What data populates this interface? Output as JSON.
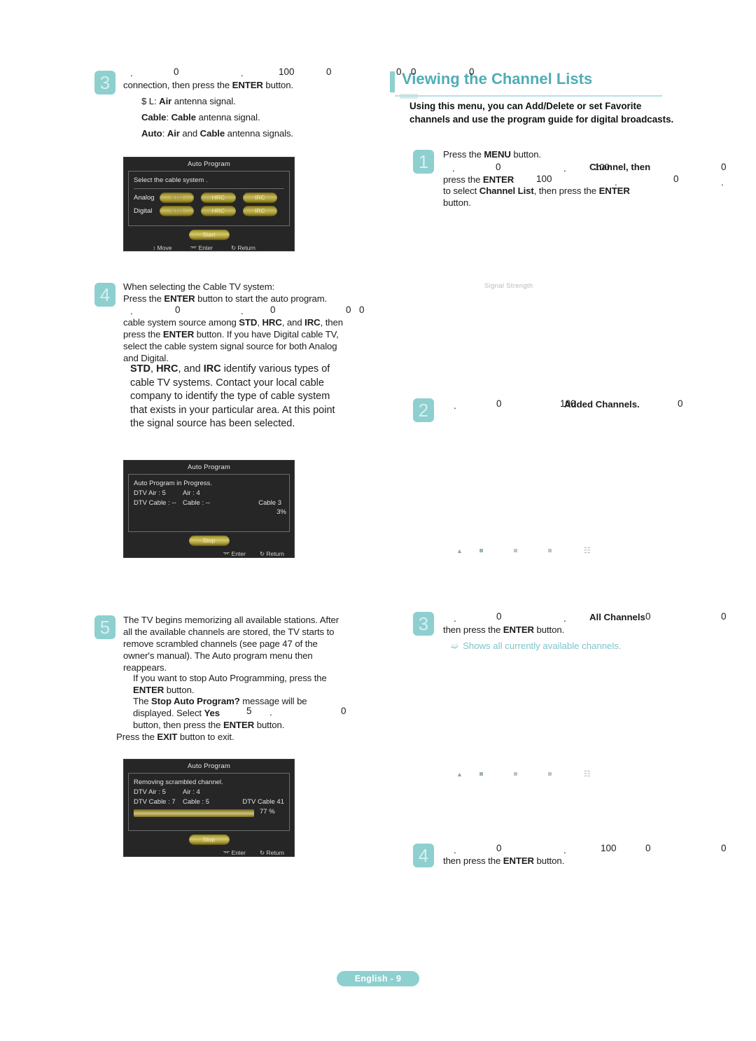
{
  "document": {
    "footer_label": "English - 9",
    "accent": "#8ecfcf",
    "heading_color": "#4fadb5",
    "note_color": "#7ec4cc"
  },
  "left_column": {
    "step3": {
      "number": "3",
      "stray_a": ".",
      "stray_b": "0",
      "stray_c": ".",
      "stray_d": "100",
      "stray_e": "0",
      "line1": "connection, then press the ENTER button.",
      "bullets": [
        "$ L: Air antenna signal.",
        "Cable: Cable antenna signal.",
        "Auto: Air and Cable antenna signals."
      ]
    },
    "osd1": {
      "title": "Auto Program",
      "prompt": "Select the cable system .",
      "rows": [
        {
          "label": "Analog",
          "options": [
            "STD",
            "HRC",
            "IRC"
          ]
        },
        {
          "label": "Digital",
          "options": [
            "STD",
            "HRC",
            "IRC"
          ]
        }
      ],
      "start_button": "Start",
      "footer": [
        "Move",
        "Enter",
        "Return"
      ]
    },
    "step4": {
      "number": "4",
      "line1": "When selecting the Cable TV system:",
      "line2": "Press the ENTER button to start the auto program.",
      "stray_a": ".",
      "stray_b": "0",
      "stray_c": ".",
      "stray_d": "0",
      "stray_e": "0",
      "stray_f": "0",
      "body": "cable system source among STD, HRC, and IRC, then press the ENTER button. If you have Digital cable TV, select the cable system signal source for both Analog and Digital.",
      "sub": "STD, HRC, and IRC identify various types of cable TV systems. Contact your local cable company to identify the type of cable system that exists in your particular area. At this point the signal source has been selected."
    },
    "osd2": {
      "title": "Auto Program",
      "status": "Auto Program in Progress.",
      "stats": [
        {
          "left": "DTV Air : 5",
          "right": "Air : 4"
        },
        {
          "left": "DTV Cable : --",
          "right": "Cable : --"
        }
      ],
      "current_channel": "Cable 3",
      "percent": "3%",
      "stop_button": "Stop",
      "footer": [
        "Enter",
        "Return"
      ]
    },
    "step5": {
      "number": "5",
      "body": "The TV begins memorizing all available stations. After all the available channels are stored, the TV starts to remove scrambled channels (see page 47 of the owner's manual). The Auto program menu then reappears.",
      "sub1": "If you want to stop Auto Programming, press the ENTER button.",
      "sub2_a": "The Stop Auto Program? message will be",
      "sub2_b": "displayed. Select Yes",
      "sub2_stray1": "5",
      "sub2_stray2": ".",
      "sub2_stray3": "0",
      "sub2_c": "button, then press the ENTER button.",
      "last": "Press the EXIT button to exit."
    },
    "osd3": {
      "title": "Auto Program",
      "status": "Removing scrambled channel.",
      "stats": [
        {
          "left": "DTV Air : 5",
          "right": "Air : 4"
        },
        {
          "left": "DTV Cable : 7",
          "right": "Cable : 5"
        }
      ],
      "current_channel": "DTV Cable 41",
      "percent": "77 %",
      "progress": 77,
      "stop_button": "Stop",
      "footer": [
        "Enter",
        "Return"
      ]
    }
  },
  "right_column": {
    "heading": "Viewing the Channel Lists",
    "heading_strays": [
      "0",
      "0",
      "0"
    ],
    "intro": "Using this menu, you can Add/Delete or set Favorite channels and use the program guide for digital broadcasts.",
    "step1": {
      "number": "1",
      "line1": "Press the MENU button.",
      "stray_a": ".",
      "stray_b": "0",
      "stray_c": ".",
      "stray_overlap": "Channel, then",
      "stray_overlap2": "100",
      "stray_d": "0",
      "line2a": "press the ENTER",
      "stray_e": "100",
      "stray_f": ".",
      "stray_g": "0",
      "stray_h": ".",
      "line3": "to select Channel List, then press the ENTER",
      "line4": "button."
    },
    "signal_strength_label": "Signal Strength",
    "step2": {
      "number": "2",
      "stray_a": ".",
      "stray_b": "0",
      "stray_c": "100",
      "emphasis": "Added Channels.",
      "stray_d": "0"
    },
    "step3": {
      "number": "3",
      "stray_a": ".",
      "stray_b": "0",
      "stray_c": ".",
      "emphasis": "All Channels",
      "stray_d": "0",
      "stray_e": "0",
      "line2": "then press the ENTER button.",
      "note": "Shows all currently available channels."
    },
    "step4": {
      "number": "4",
      "stray_a": ".",
      "stray_b": "0",
      "stray_c": ".",
      "stray_d": "100",
      "stray_e": "0",
      "stray_f": "0",
      "line2": "then press the ENTER button."
    }
  }
}
